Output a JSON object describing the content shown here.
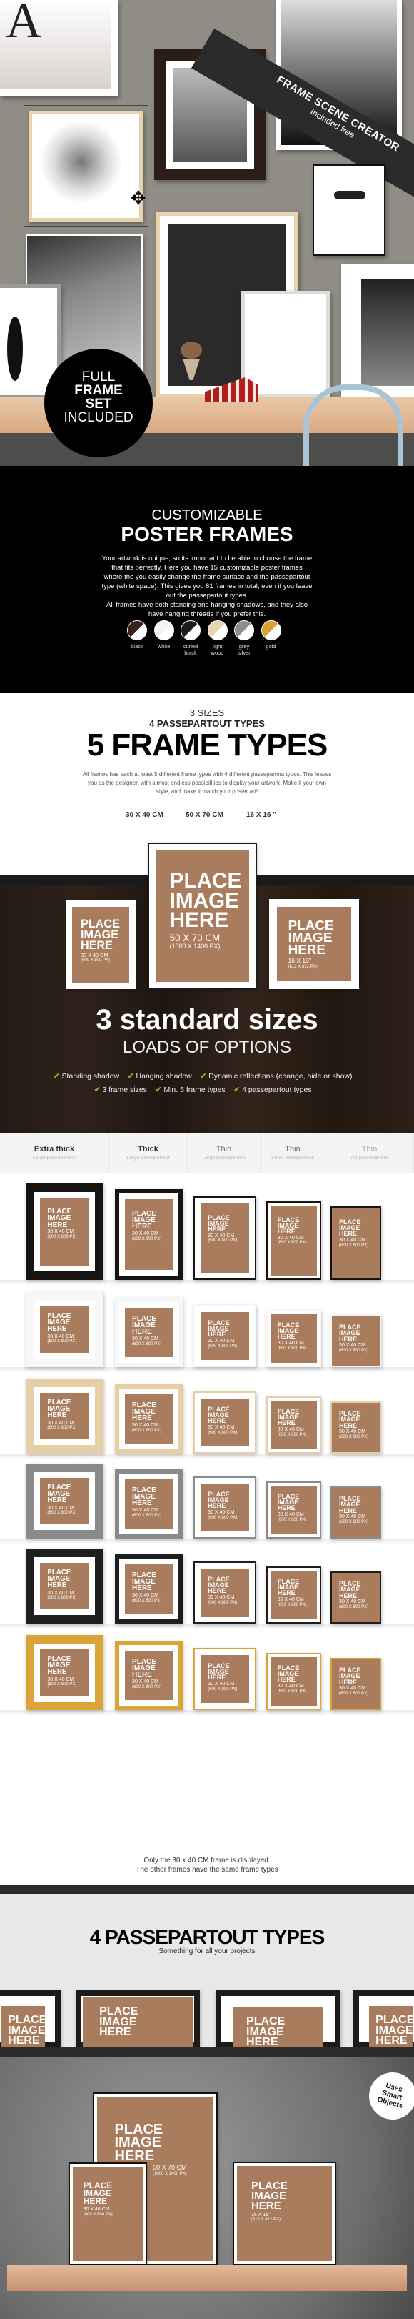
{
  "hero": {
    "ribbon_title": "FRAME SCENE CREATOR",
    "ribbon_sub": "Included free",
    "badge": {
      "line1": "FULL",
      "line2": "FRAME",
      "line3": "SET",
      "line4": "INCLUDED"
    }
  },
  "customize": {
    "title_light": "CUSTOMIZABLE",
    "title_bold": "POSTER FRAMES",
    "para1": "Your artwork is unique, so its important to be able to choose the frame that fits perfectly. Here you have 15 customizable poster frames where the you easily change the frame surface and the passepartout type (white space). This gives you 81 frames in total, even if you leave out the passepartout types.",
    "para2": "All frames have both standing and hanging shadows, and they also have hanging threads if you prefer this.",
    "swatches": [
      {
        "label": "black",
        "color": "#3a2218"
      },
      {
        "label": "white",
        "color": "#f4f4f4"
      },
      {
        "label": "curled black",
        "color": "#1c1c1c"
      },
      {
        "label": "light wood",
        "color": "#e8d3b0"
      },
      {
        "label": "grey silver",
        "color": "#8e8e8e"
      },
      {
        "label": "gold",
        "color": "#d9a131"
      }
    ]
  },
  "types": {
    "line1": "3 SIZES",
    "line2": "4 PASSEPARTOUT TYPES",
    "title": "5 FRAME TYPES",
    "para": "All frames has each at least 5 different frame types with 4 different passepartout types. This leaves you as the designer, with almost endless possibilities to display your artwork. Make it your own style, and make it match your poster art!",
    "sizes": [
      "30 X 40 CM",
      "50 X 70 CM",
      "16 X 16 \""
    ]
  },
  "placeholder": {
    "text": "PLACE IMAGE HERE",
    "lines": [
      "PLACE",
      "IMAGE",
      "HERE"
    ]
  },
  "standard": {
    "frames": [
      {
        "size": "30 X 40 CM",
        "px": "(600 X 800 PX)"
      },
      {
        "size": "50 X 70 CM",
        "px": "(1000 X 1400 PX)"
      },
      {
        "size": "16 X 16\"",
        "px": "(812 X 812 PX)"
      }
    ],
    "title": "3 standard sizes",
    "subtitle": "LOADS OF OPTIONS",
    "features_row1": [
      "Standing shadow",
      "Hanging shadow",
      "Dynamic reflections (change, hide or show)"
    ],
    "features_row2": [
      "3 frame sizes",
      "Min. 5 frame types",
      "4 passepartout types"
    ],
    "check_color": "#8bb33a"
  },
  "grid": {
    "columns": [
      {
        "title": "Extra thick",
        "sub": "Large passepartout"
      },
      {
        "title": "Thick",
        "sub": "Large passepartout"
      },
      {
        "title": "Thin",
        "sub": "Large passepartout"
      },
      {
        "title": "Thin",
        "sub": "Small passepartout"
      },
      {
        "title": "Thin",
        "sub": "No passepartout"
      }
    ],
    "rows": [
      {
        "finish": "black",
        "color": "#161310"
      },
      {
        "finish": "white",
        "color": "#f7f7f7"
      },
      {
        "finish": "light wood",
        "color": "#e6cfa7"
      },
      {
        "finish": "grey silver",
        "color": "#8a8a8a"
      },
      {
        "finish": "curled black",
        "color": "#1e1e1e"
      },
      {
        "finish": "gold",
        "color": "#dba437"
      }
    ],
    "frame_size": "30 X 40 CM",
    "frame_px": "(600 X 800 PX)",
    "note1": "Only the 30 x 40 CM frame is displayed.",
    "note2": "The other frames have the same frame types"
  },
  "passepartout": {
    "title": "4 PASSEPARTOUT TYPES",
    "subtitle": "Something for all your projects",
    "badge": "Uses Smart Objects",
    "frames": [
      {
        "size": "30 X 40 CM",
        "px": "(600 X 800 PX)"
      },
      {
        "size": "50 X 70 CM",
        "px": "(1000 X 1400 PX)"
      },
      {
        "size": "16 X 16\"",
        "px": "(812 X 812 PX)"
      }
    ]
  },
  "colors": {
    "placeholder": "#a97c5d",
    "wall": "#8f8d85"
  }
}
